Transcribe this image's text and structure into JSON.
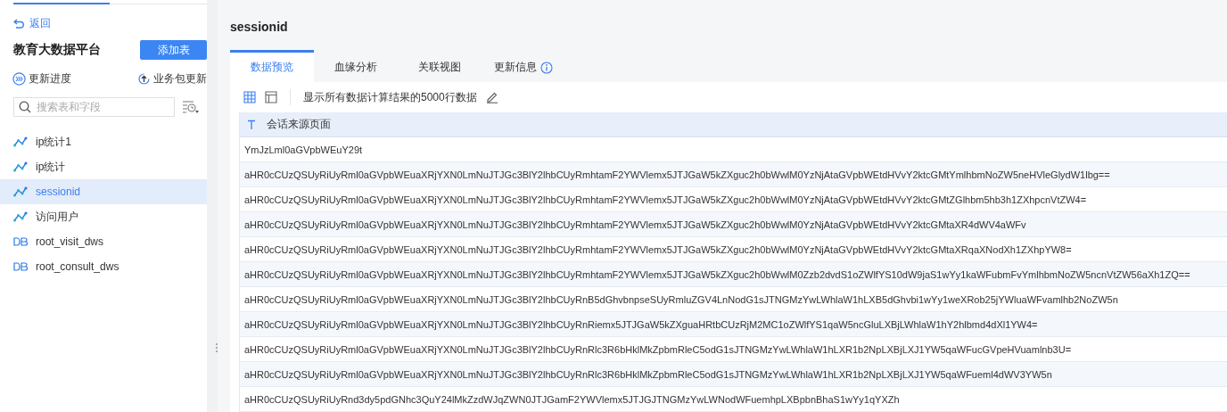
{
  "sidebar": {
    "back_link": "返回",
    "title": "教育大数据平台",
    "add_button": "添加表",
    "actions": [
      {
        "kind": "progress",
        "label": "更新进度"
      },
      {
        "kind": "upload",
        "label": "业务包更新"
      }
    ],
    "search": {
      "placeholder": "搜索表和字段"
    },
    "items": [
      {
        "kind": "analysis",
        "label": "ip统计1",
        "selected": false
      },
      {
        "kind": "analysis",
        "label": "ip统计",
        "selected": false
      },
      {
        "kind": "analysis",
        "label": "sessionid",
        "selected": true
      },
      {
        "kind": "analysis",
        "label": "访问用户",
        "selected": false
      },
      {
        "kind": "db",
        "label": "root_visit_dws",
        "selected": false
      },
      {
        "kind": "db",
        "label": "root_consult_dws",
        "selected": false
      }
    ]
  },
  "main": {
    "title": "sessionid",
    "tabs": [
      {
        "label": "数据预览",
        "selected": true,
        "info": false
      },
      {
        "label": "血缘分析",
        "selected": false,
        "info": false
      },
      {
        "label": "关联视图",
        "selected": false,
        "info": false
      },
      {
        "label": "更新信息",
        "selected": false,
        "info": true
      }
    ],
    "toolbar": {
      "views": [
        {
          "kind": "grid",
          "selected": true
        },
        {
          "kind": "panel",
          "selected": false
        }
      ],
      "note": "显示所有数据计算结果的5000行数据"
    },
    "table": {
      "columns": [
        {
          "kind": "text",
          "label": "会话来源页面"
        }
      ],
      "rows": [
        "YmJzLml0aGVpbWEuY29t",
        "aHR0cCUzQSUyRiUyRml0aGVpbWEuaXRjYXN0LmNuJTJGc3BlY2lhbCUyRmhtamF2YWVlemx5JTJGaW5kZXguc2h0bWwlM0YzNjAtaGVpbWEtdHVvY2ktcGMtYmlhbmNoZW5neHVleGlydW1lbg==",
        "aHR0cCUzQSUyRiUyRml0aGVpbWEuaXRjYXN0LmNuJTJGc3BlY2lhbCUyRmhtamF2YWVlemx5JTJGaW5kZXguc2h0bWwlM0YzNjAtaGVpbWEtdHVvY2ktcGMtZGlhbm5hb3h1ZXhpcnVtZW4=",
        "aHR0cCUzQSUyRiUyRml0aGVpbWEuaXRjYXN0LmNuJTJGc3BlY2lhbCUyRmhtamF2YWVlemx5JTJGaW5kZXguc2h0bWwlM0YzNjAtaGVpbWEtdHVvY2ktcGMtaXR4dWV4aWFv",
        "aHR0cCUzQSUyRiUyRml0aGVpbWEuaXRjYXN0LmNuJTJGc3BlY2lhbCUyRmhtamF2YWVlemx5JTJGaW5kZXguc2h0bWwlM0YzNjAtaGVpbWEtdHVvY2ktcGMtaXRqaXNodXh1ZXhpYW8=",
        "aHR0cCUzQSUyRiUyRml0aGVpbWEuaXRjYXN0LmNuJTJGc3BlY2lhbCUyRmhtamF2YWVlemx5JTJGaW5kZXguc2h0bWwlM0Zzb2dvdS1oZWlfYS10dW9jaS1wYy1kaWFubmFvYmlhbmNoZW5ncnVtZW56aXh1ZQ==",
        "aHR0cCUzQSUyRiUyRml0aGVpbWEuaXRjYXN0LmNuJTJGc3BlY2lhbCUyRnB5dGhvbnpseSUyRmluZGV4LnNodG1sJTNGMzYwLWhlaW1hLXB5dGhvbi1wYy1weXRob25jYWluaWFvamlhb2NoZW5n",
        "aHR0cCUzQSUyRiUyRml0aGVpbWEuaXRjYXN0LmNuJTJGc3BlY2lhbCUyRnRiemx5JTJGaW5kZXguaHRtbCUzRjM2MC1oZWlfYS1qaW5ncGluLXBjLWhlaW1hY2hlbmd4dXl1YW4=",
        "aHR0cCUzQSUyRiUyRml0aGVpbWEuaXRjYXN0LmNuJTJGc3BlY2lhbCUyRnRlc3R6bHklMkZpbmRleC5odG1sJTNGMzYwLWhlaW1hLXR1b2NpLXBjLXJ1YW5qaWFucGVpeHVuamlnb3U=",
        "aHR0cCUzQSUyRiUyRml0aGVpbWEuaXRjYXN0LmNuJTJGc3BlY2lhbCUyRnRlc3R6bHklMkZpbmRleC5odG1sJTNGMzYwLWhlaW1hLXR1b2NpLXBjLXJ1YW5qaWFueml4dWV3YW5n",
        "aHR0cCUzQSUyRiUyRnd3dy5pdGNhc3QuY24lMkZzdWJqZWN0JTJGamF2YWVlemx5JTJGJTNGMzYwLWNodWFuemhpLXBpbnBhaS1wYy1qYXZh"
      ]
    }
  }
}
